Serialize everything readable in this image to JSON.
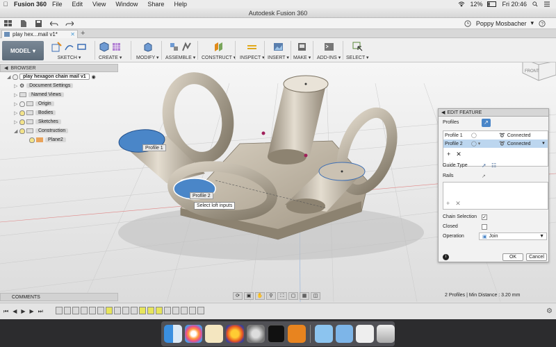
{
  "menubar": {
    "app_name": "Fusion 360",
    "items": [
      "File",
      "Edit",
      "View",
      "Window",
      "Share",
      "Help"
    ],
    "battery": "12%",
    "clock": "Fri 20:46"
  },
  "window": {
    "title": "Autodesk Fusion 360"
  },
  "user": {
    "name": "Poppy Mosbacher"
  },
  "doc_tab": {
    "label": "play hex...mail v1*"
  },
  "workspace": {
    "label": "MODEL"
  },
  "ribbon": {
    "groups": [
      "SKETCH",
      "CREATE",
      "MODIFY",
      "ASSEMBLE",
      "CONSTRUCT",
      "INSPECT",
      "INSERT",
      "MAKE",
      "ADD-INS",
      "SELECT"
    ]
  },
  "viewcube": {
    "label": "FRONT"
  },
  "browser": {
    "header": "BROWSER",
    "root": "play hexagon chain mail v1",
    "items": [
      {
        "label": "Document Settings"
      },
      {
        "label": "Named Views"
      },
      {
        "label": "Origin"
      },
      {
        "label": "Bodies"
      },
      {
        "label": "Sketches"
      },
      {
        "label": "Construction"
      },
      {
        "label": "Plane2"
      }
    ]
  },
  "edit_feature": {
    "title": "EDIT FEATURE",
    "profiles_label": "Profiles",
    "rows": [
      {
        "name": "Profile 1",
        "status": "Connected",
        "selected": false
      },
      {
        "name": "Profile 2",
        "status": "Connected",
        "selected": true
      }
    ],
    "guide_type_label": "Guide Type",
    "rails_label": "Rails",
    "chain_selection_label": "Chain Selection",
    "chain_selection_checked": true,
    "closed_label": "Closed",
    "closed_checked": false,
    "operation_label": "Operation",
    "operation_value": "Join",
    "ok_label": "OK",
    "cancel_label": "Cancel"
  },
  "canvas": {
    "profile1_label": "Profile 1",
    "profile2_label": "Profile 2",
    "tooltip": "Select loft inputs"
  },
  "comments": {
    "label": "COMMENTS"
  },
  "status": {
    "text": "2 Profiles | Min Distance : 3.20 mm"
  },
  "colors": {
    "accent": "#4a86c8",
    "highlight": "#e7e55c",
    "body": "#bdb3a2"
  }
}
